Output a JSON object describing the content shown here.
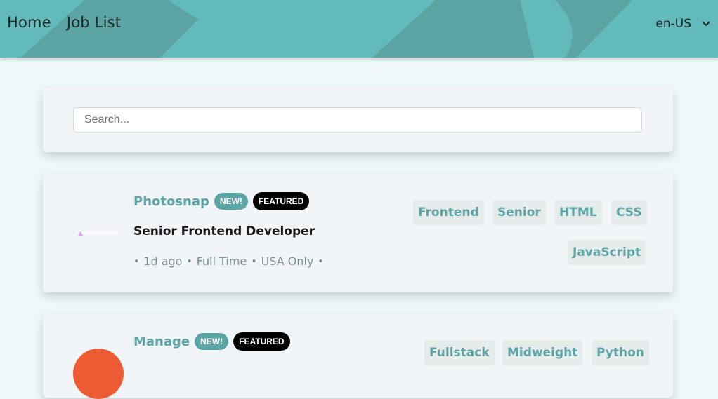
{
  "nav": {
    "home": "Home",
    "job_list": "Job List"
  },
  "language": {
    "selected": "en-US"
  },
  "search": {
    "placeholder": "Search..."
  },
  "jobs": [
    {
      "company": "Photosnap",
      "logo_text": "PHOTOSNAP",
      "logo_color": "#000000",
      "new_label": "NEW!",
      "featured_label": "FEATURED",
      "position": "Senior Frontend Developer",
      "posted": "1d ago",
      "contract": "Full Time",
      "location": "USA Only",
      "tags": [
        "Frontend",
        "Senior",
        "HTML",
        "CSS",
        "JavaScript"
      ]
    },
    {
      "company": "Manage",
      "logo_color": "#ee5a34",
      "new_label": "NEW!",
      "featured_label": "FEATURED",
      "tags": [
        "Fullstack",
        "Midweight",
        "Python"
      ]
    }
  ],
  "colors": {
    "header": "#63babb",
    "accent": "#5ca5a5",
    "background": "#eff9f9",
    "card": "#f1f5f7"
  }
}
